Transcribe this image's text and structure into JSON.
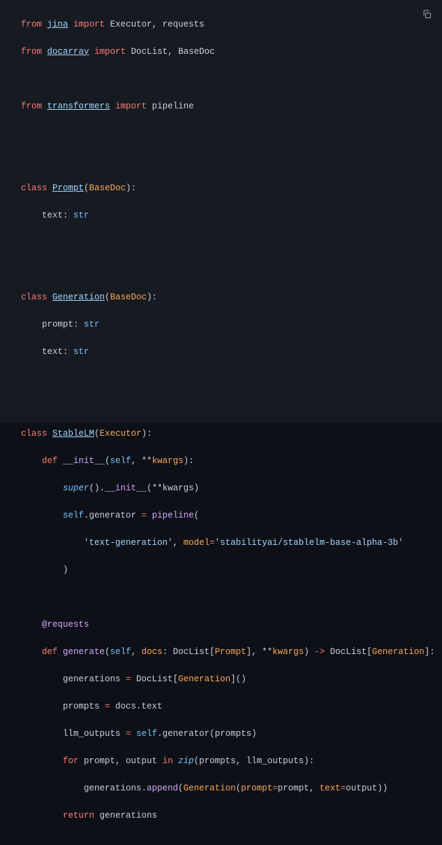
{
  "copy_button_tooltip": "Copy",
  "code": {
    "l1": {
      "kw_from": "from",
      "mod_jina": "jina",
      "kw_import": "import",
      "n_exec": "Executor",
      "p_c": ", ",
      "n_req": "requests"
    },
    "l2": {
      "kw_from": "from",
      "mod_docarray": "docarray",
      "kw_import": "import",
      "n_doclist": "DocList",
      "p_c": ", ",
      "n_basedoc": "BaseDoc"
    },
    "l3": {},
    "l4": {
      "kw_from": "from",
      "mod_transformers": "transformers",
      "kw_import": "import",
      "n_pipeline": "pipeline"
    },
    "l5": {},
    "l6": {},
    "l7": {
      "kw_class": "class",
      "cls_Prompt": "Prompt",
      "p_paren_open": "(",
      "base": "BaseDoc",
      "p_paren_close_colon": "):"
    },
    "l8": {
      "field": "text",
      "colon": ": ",
      "type": "str"
    },
    "l9": {},
    "l10": {},
    "l11": {
      "kw_class": "class",
      "cls_Generation": "Generation",
      "p_paren_open": "(",
      "base": "BaseDoc",
      "p_paren_close_colon": "):"
    },
    "l12": {
      "field": "prompt",
      "colon": ": ",
      "type": "str"
    },
    "l13": {
      "field": "text",
      "colon": ": ",
      "type": "str"
    },
    "l14": {},
    "l15": {},
    "l16": {
      "kw_class": "class",
      "cls_StableLM": "StableLM",
      "p_paren_open": "(",
      "base": "Executor",
      "p_paren_close_colon": "):"
    },
    "l17": {
      "kw_def": "def",
      "fn": "__init__",
      "p1": "(",
      "self": "self",
      "p2": ", **",
      "kwargs": "kwargs",
      "p3": "):"
    },
    "l18": {
      "super": "super",
      "p1": "().",
      "init": "__init__",
      "p2": "(**kwargs)"
    },
    "l19": {
      "self": "self",
      "dot": ".generator ",
      "eq": "=",
      "sp": " ",
      "pipeline": "pipeline",
      "p": "("
    },
    "l20": {
      "s1": "'text-generation'",
      "c": ", ",
      "arg": "model",
      "eq": "=",
      "s2": "'stabilityai/stablelm-base-alpha-3b'"
    },
    "l21": {
      "p": ")"
    },
    "l22": {},
    "l23": {
      "dec": "@requests"
    },
    "l24": {
      "kw_def": "def",
      "fn": "generate",
      "p1": "(",
      "self": "self",
      "c1": ", ",
      "docs": "docs",
      "colon1": ": DocList[",
      "prompt": "Prompt",
      "b1": "], **",
      "kwargs": "kwargs",
      "p2": ") ",
      "arrow": "->",
      "sp": " DocList[",
      "gen": "Generation",
      "end": "]:"
    },
    "l25": {
      "lhs": "generations ",
      "eq": "=",
      "rhs1": " DocList[",
      "gen": "Generation",
      "rhs2": "]()"
    },
    "l26": {
      "lhs": "prompts ",
      "eq": "=",
      "rhs": " docs.text"
    },
    "l27": {
      "lhs": "llm_outputs ",
      "eq": "=",
      "sp": " ",
      "self": "self",
      "rhs": ".generator(prompts)"
    },
    "l28": {
      "kw_for": "for",
      "sp1": " prompt, output ",
      "kw_in": "in",
      "sp2": " ",
      "zip": "zip",
      "p": "(prompts, llm_outputs):"
    },
    "l29": {
      "pre": "generations.",
      "append": "append",
      "p1": "(",
      "gen": "Generation",
      "p2": "(",
      "a1": "prompt",
      "eq1": "=",
      "v1": "prompt",
      "c": ", ",
      "a2": "text",
      "eq2": "=",
      "v2": "output",
      "p3": "))"
    },
    "l30": {
      "kw_return": "return",
      "sp": " generations"
    }
  }
}
